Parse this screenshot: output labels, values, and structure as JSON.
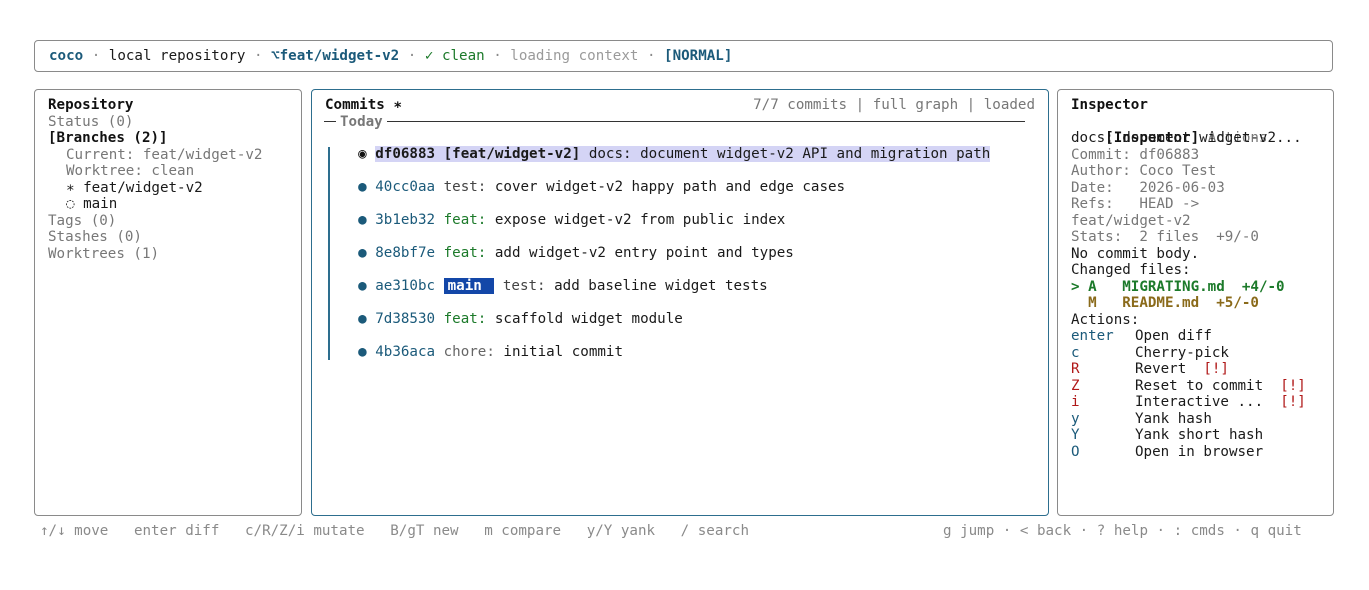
{
  "topbar": {
    "app": "coco",
    "repo": "local repository",
    "branch_icon": "⌥",
    "branch": "feat/widget-v2",
    "clean": "✓ clean",
    "context": "loading context",
    "mode": "[NORMAL]",
    "dot": "·"
  },
  "repository": {
    "title": "Repository",
    "status": "Status (0)",
    "branches": "[Branches (2)]",
    "current": "Current: feat/widget-v2",
    "worktree": "Worktree: clean",
    "branch_items": [
      "∗ feat/widget-v2",
      "◌ main"
    ],
    "tags": "Tags (0)",
    "stashes": "Stashes (0)",
    "worktrees": "Worktrees (1)"
  },
  "commits": {
    "title": "Commits ∗",
    "summary": "7/7 commits | full graph | loaded",
    "group": "Today",
    "rows": [
      {
        "hash": "df06883",
        "ref": "[feat/widget-v2]",
        "kind": "",
        "message": "docs: document widget-v2 API and migration path",
        "selected": true
      },
      {
        "hash": "40cc0aa",
        "ref": "",
        "kind": "test:",
        "message": "cover widget-v2 happy path and edge cases"
      },
      {
        "hash": "3b1eb32",
        "ref": "",
        "kind": "feat:",
        "message": "expose widget-v2 from public index"
      },
      {
        "hash": "8e8bf7e",
        "ref": "",
        "kind": "feat:",
        "message": "add widget-v2 entry point and types"
      },
      {
        "hash": "ae310bc",
        "ref": "main",
        "kind": "test:",
        "message": "add baseline widget tests"
      },
      {
        "hash": "7d38530",
        "ref": "",
        "kind": "feat:",
        "message": "scaffold widget module"
      },
      {
        "hash": "4b36aca",
        "ref": "",
        "kind": "chore:",
        "message": "initial commit"
      }
    ]
  },
  "inspector": {
    "title": "Inspector",
    "tab_active": "[Inspector]",
    "tab_other": "Actions",
    "subject": "docs: document widget-v2...",
    "commit": "Commit: df06883",
    "author": "Author: Coco Test",
    "date": "Date:   2026-06-03",
    "refs": "Refs:   HEAD ->",
    "refs2": "feat/widget-v2",
    "stats": "Stats:  2 files  +9/-0",
    "body": "No commit body.",
    "changed_title": "Changed files:",
    "files": [
      {
        "marker": ">",
        "status": "A",
        "name": "MIGRATING.md",
        "delta": "+4/-0"
      },
      {
        "marker": " ",
        "status": "M",
        "name": "README.md",
        "delta": "+5/-0"
      }
    ],
    "actions_title": "Actions:",
    "actions": [
      {
        "key": "enter",
        "label": "Open diff",
        "warn": ""
      },
      {
        "key": "c",
        "label": "Cherry-pick",
        "warn": ""
      },
      {
        "key": "R",
        "label": "Revert",
        "warn": "[!]"
      },
      {
        "key": "Z",
        "label": "Reset to commit",
        "warn": "[!]"
      },
      {
        "key": "i",
        "label": "Interactive ...",
        "warn": "[!]"
      },
      {
        "key": "y",
        "label": "Yank hash",
        "warn": ""
      },
      {
        "key": "Y",
        "label": "Yank short hash",
        "warn": ""
      },
      {
        "key": "O",
        "label": "Open in browser",
        "warn": ""
      }
    ]
  },
  "footer": {
    "left": [
      "↑/↓ move",
      "enter diff",
      "c/R/Z/i mutate",
      "B/gT new",
      "m compare",
      "y/Y yank",
      "/ search"
    ],
    "right": "g jump · < back · ? help · : cmds · q quit"
  },
  "colors": {
    "accent": "#1b5a7a",
    "green": "#1c7a2a",
    "warn": "#b01818",
    "selection": "#d4d4f5",
    "badge": "#1347a8"
  }
}
